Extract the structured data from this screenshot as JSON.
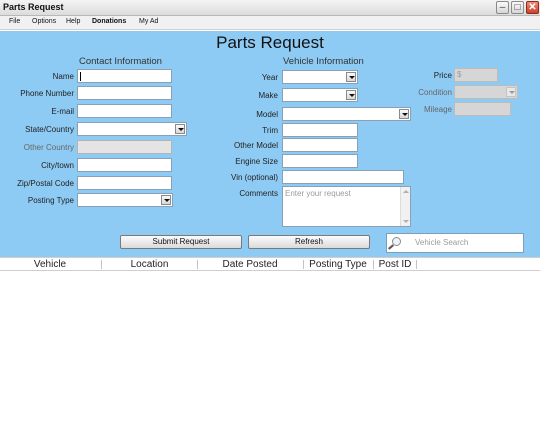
{
  "window": {
    "title": "Parts Request",
    "minimize_glyph": "–",
    "maximize_glyph": "□",
    "close_glyph": "✕"
  },
  "menu": [
    "File",
    "Options",
    "Help",
    "Donations",
    "My Ad"
  ],
  "heading": "Parts Request",
  "contact": {
    "section_title": "Contact Information",
    "name_label": "Name",
    "phone_label": "Phone Number",
    "email_label": "E-mail",
    "state_label": "State/Country",
    "other_country_label": "Other Country",
    "city_label": "City/town",
    "zip_label": "Zip/Postal Code",
    "posting_type_label": "Posting Type"
  },
  "vehicle": {
    "section_title": "Vehicle Information",
    "year_label": "Year",
    "make_label": "Make",
    "model_label": "Model",
    "trim_label": "Trim",
    "other_model_label": "Other Model",
    "engine_label": "Engine Size",
    "vin_label": "Vin (optional)",
    "comments_label": "Comments",
    "comments_placeholder": "Enter your request"
  },
  "pricing": {
    "price_label": "Price",
    "price_placeholder": "$",
    "condition_label": "Condition",
    "mileage_label": "Mileage"
  },
  "buttons": {
    "submit": "Submit Request",
    "refresh": "Refresh"
  },
  "search": {
    "placeholder": "Vehicle Search",
    "icon": "magnifier-icon"
  },
  "results": {
    "columns": [
      "Vehicle",
      "Location",
      "Date Posted",
      "Posting Type",
      "Post ID"
    ]
  },
  "colors": {
    "form_bg": "#8ecbf4",
    "close_button": "#c8412c"
  }
}
